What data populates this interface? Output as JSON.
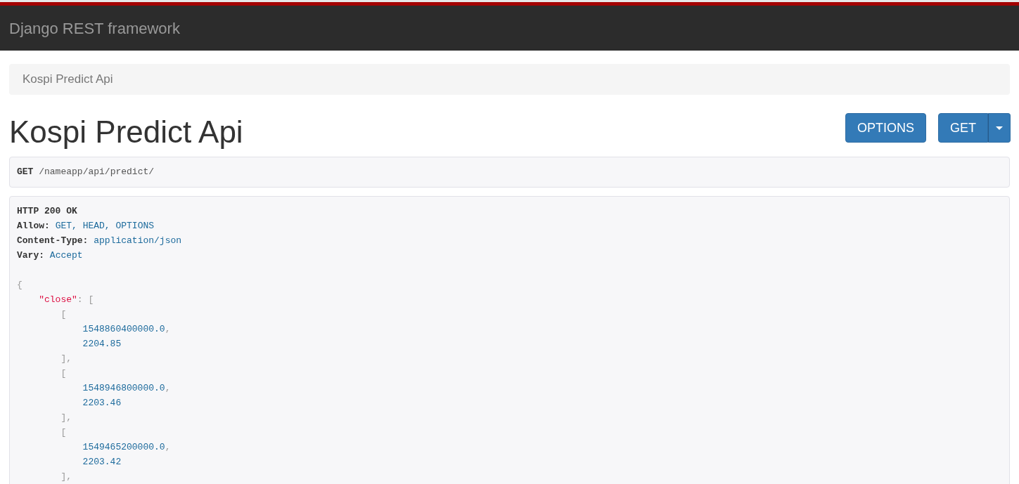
{
  "navbar": {
    "brand": "Django REST framework"
  },
  "breadcrumb": [
    {
      "label": "Kospi Predict Api",
      "selected": true
    }
  ],
  "page": {
    "title": "Kospi Predict Api"
  },
  "buttons": [
    {
      "kind": "plain",
      "label": "OPTIONS"
    },
    {
      "kind": "split",
      "label": "GET"
    }
  ],
  "request": {
    "method": "GET",
    "path": "/nameapp/api/predict/"
  },
  "response": {
    "status": "HTTP 200 OK",
    "headers": [
      {
        "name": "Allow:",
        "value": "GET, HEAD, OPTIONS"
      },
      {
        "name": "Content-Type:",
        "value": "application/json"
      },
      {
        "name": "Vary:",
        "value": "Accept"
      }
    ],
    "body": [
      {
        "tokens": [
          {
            "kind": "punct",
            "text": "{"
          }
        ],
        "children": [
          {
            "tokens": [
              {
                "kind": "key",
                "text": "\"close\""
              },
              {
                "kind": "punct",
                "text": ": ["
              }
            ],
            "children": [
              {
                "tokens": [
                  {
                    "kind": "punct",
                    "text": "["
                  }
                ],
                "children": [
                  {
                    "tokens": [
                      {
                        "kind": "number",
                        "text": "1548860400000.0"
                      },
                      {
                        "kind": "punct",
                        "text": ","
                      }
                    ]
                  },
                  {
                    "tokens": [
                      {
                        "kind": "number",
                        "text": "2204.85"
                      }
                    ]
                  }
                ]
              },
              {
                "tokens": [
                  {
                    "kind": "punct",
                    "text": "],"
                  }
                ]
              },
              {
                "tokens": [
                  {
                    "kind": "punct",
                    "text": "["
                  }
                ],
                "children": [
                  {
                    "tokens": [
                      {
                        "kind": "number",
                        "text": "1548946800000.0"
                      },
                      {
                        "kind": "punct",
                        "text": ","
                      }
                    ]
                  },
                  {
                    "tokens": [
                      {
                        "kind": "number",
                        "text": "2203.46"
                      }
                    ]
                  }
                ]
              },
              {
                "tokens": [
                  {
                    "kind": "punct",
                    "text": "],"
                  }
                ]
              },
              {
                "tokens": [
                  {
                    "kind": "punct",
                    "text": "["
                  }
                ],
                "children": [
                  {
                    "tokens": [
                      {
                        "kind": "number",
                        "text": "1549465200000.0"
                      },
                      {
                        "kind": "punct",
                        "text": ","
                      }
                    ]
                  },
                  {
                    "tokens": [
                      {
                        "kind": "number",
                        "text": "2203.42"
                      }
                    ]
                  }
                ]
              },
              {
                "tokens": [
                  {
                    "kind": "punct",
                    "text": "],"
                  }
                ]
              }
            ]
          }
        ]
      }
    ]
  }
}
